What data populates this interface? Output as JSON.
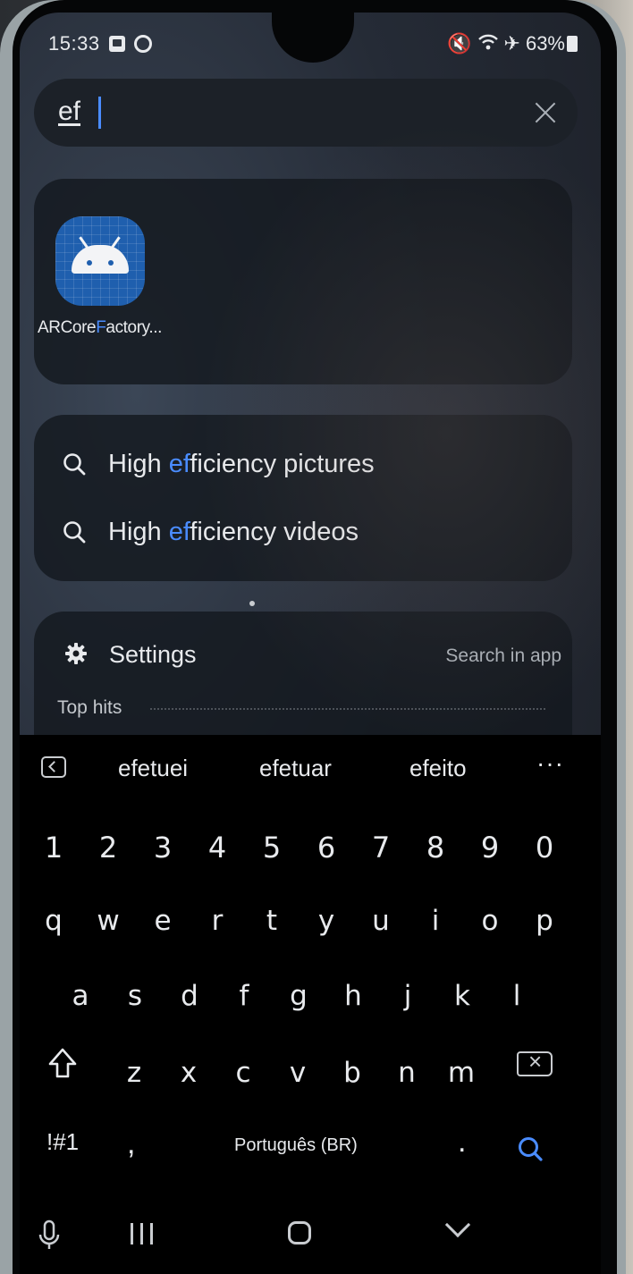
{
  "status_bar": {
    "time": "15:33",
    "battery": "63%",
    "icons": [
      "gallery-notification-icon",
      "sync-notification-icon",
      "mute-icon",
      "wifi-icon",
      "airplane-mode-icon",
      "battery-icon"
    ]
  },
  "search": {
    "query": "ef",
    "clear_icon": "close-icon"
  },
  "apps": [
    {
      "label_before": "ARCore",
      "label_match": "F",
      "label_after": "actory...",
      "icon": "android-app-icon"
    }
  ],
  "match_prefix": "ef",
  "suggestions": [
    {
      "before": "High ",
      "match": "ef",
      "after": "ficiency pictures"
    },
    {
      "before": "High ",
      "match": "ef",
      "after": "ficiency videos"
    }
  ],
  "settings_section": {
    "title": "Settings",
    "action": "Search in app",
    "subheading": "Top hits"
  },
  "keyboard": {
    "predictions": [
      "efetuei",
      "efetuar",
      "efeito"
    ],
    "more": "···",
    "rows": [
      [
        "1",
        "2",
        "3",
        "4",
        "5",
        "6",
        "7",
        "8",
        "9",
        "0"
      ],
      [
        "q",
        "w",
        "e",
        "r",
        "t",
        "y",
        "u",
        "i",
        "o",
        "p"
      ],
      [
        "a",
        "s",
        "d",
        "f",
        "g",
        "h",
        "j",
        "k",
        "l"
      ],
      [
        "z",
        "x",
        "c",
        "v",
        "b",
        "n",
        "m"
      ]
    ],
    "symbols_key": "!#1",
    "comma_key": ",",
    "space_label": "Português (BR)",
    "period_key": ".",
    "accent_color": "#4a8cff"
  },
  "navigation": {
    "icons": [
      "microphone-icon",
      "recent-apps-icon",
      "home-icon",
      "back-icon"
    ]
  }
}
